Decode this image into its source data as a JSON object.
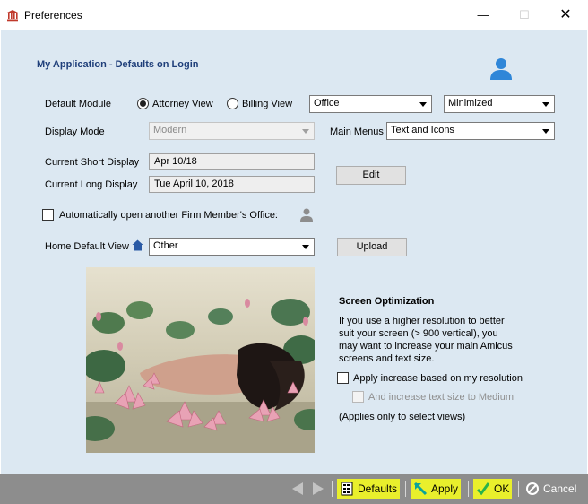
{
  "window": {
    "title": "Preferences"
  },
  "header": {
    "title": "My Application - Defaults on Login"
  },
  "default_module": {
    "label": "Default Module",
    "options": [
      {
        "label": "Attorney View",
        "checked": true
      },
      {
        "label": "Billing View",
        "checked": false
      }
    ],
    "office_select": "Office",
    "state_select": "Minimized"
  },
  "display_mode": {
    "label": "Display Mode",
    "value": "Modern"
  },
  "main_menus": {
    "label": "Main Menus",
    "value": "Text and Icons"
  },
  "short_display": {
    "label": "Current Short Display",
    "value": "Apr 10/18"
  },
  "long_display": {
    "label": "Current Long Display",
    "value": "Tue April 10, 2018"
  },
  "edit_button": "Edit",
  "auto_open": {
    "label": "Automatically open another Firm Member's Office:",
    "checked": false
  },
  "home_view": {
    "label": "Home Default View",
    "value": "Other"
  },
  "upload_button": "Upload",
  "screen_optimization": {
    "title": "Screen Optimization",
    "description": "If you use a higher resolution to better suit your screen (> 900 vertical), you may want to increase your main Amicus screens and text size.",
    "apply_label": "Apply increase based on my resolution",
    "text_size_label": "And increase text size to Medium",
    "note": "(Applies only to select views)"
  },
  "footer": {
    "defaults": "Defaults",
    "apply": "Apply",
    "ok": "OK",
    "cancel": "Cancel"
  },
  "colors": {
    "client_bg": "#dce8f2",
    "header_text": "#1f3f7a",
    "footer_bg": "#8d8d8d",
    "highlight": "#e9ef2c"
  }
}
